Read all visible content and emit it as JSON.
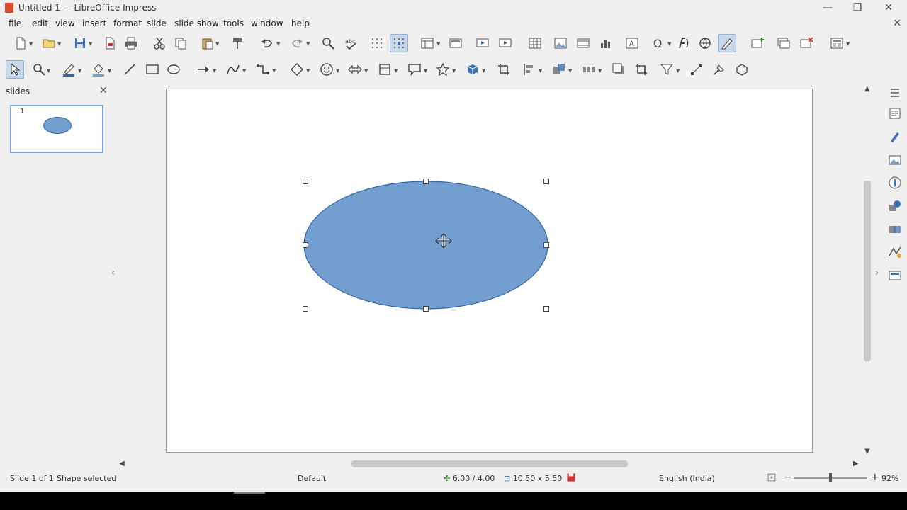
{
  "window": {
    "title": "Untitled 1 — LibreOffice Impress",
    "minimize_glyph": "—",
    "restore_glyph": "❐",
    "close_glyph": "✕"
  },
  "menu": [
    "file",
    "edit",
    "view",
    "insert",
    "format",
    "slide",
    "slide show",
    "tools",
    "window",
    "help"
  ],
  "standard_toolbar": [
    "new-icon",
    "open-icon",
    "save-icon",
    "export-pdf-icon",
    "print-icon",
    "cut-icon",
    "copy-icon",
    "paste-icon",
    "clone-formatting-icon",
    "undo-icon",
    "redo-icon",
    "find-replace-icon",
    "spelling-icon",
    "display-grid-icon",
    "snap-to-grid-icon",
    "display-views-icon",
    "master-slide-icon",
    "start-first-slide-icon",
    "start-current-slide-icon",
    "table-icon",
    "image-icon",
    "media-icon",
    "chart-icon",
    "text-box-icon",
    "special-character-icon",
    "fontwork-icon",
    "hyperlink-icon",
    "show-draw-functions-icon",
    "new-slide-icon",
    "duplicate-slide-icon",
    "delete-slide-icon",
    "slide-layout-icon"
  ],
  "drawing_toolbar": [
    "select-icon",
    "zoom-pan-icon",
    "line-color-icon",
    "fill-color-icon",
    "line-icon",
    "rectangle-icon",
    "ellipse-icon",
    "lines-arrows-icon",
    "curves-polygons-icon",
    "connectors-icon",
    "basic-shapes-icon",
    "symbol-shapes-icon",
    "block-arrows-icon",
    "flowchart-icon",
    "callouts-icon",
    "stars-icon",
    "3d-objects-icon",
    "rotate-icon",
    "align-icon",
    "arrange-icon",
    "distribute-icon",
    "shadow-icon",
    "crop-icon",
    "filter-icon",
    "points-icon",
    "glue-points-icon",
    "toggle-extrusion-icon"
  ],
  "slides_pane": {
    "title": "slides",
    "close_glyph": "✕",
    "slide_number": "1"
  },
  "canvas": {
    "shape": "ellipse",
    "fill_color": "#729fcf",
    "stroke_color": "#3465a4"
  },
  "sidebar": [
    "properties-icon",
    "styles-icon",
    "gallery-icon",
    "navigator-icon",
    "shapes-icon",
    "slide-transition-icon",
    "animation-icon",
    "master-slides-icon"
  ],
  "status": {
    "slide_info": "Slide 1 of 1",
    "selection": "Shape selected",
    "master": "Default",
    "position": "6.00 / 4.00",
    "size": "10.50 x 5.50",
    "language": "English (India)",
    "zoom": "92%",
    "zoom_fraction": 0.5
  },
  "colors": {
    "accent": "#729fcf",
    "toolbar_active": "#c9d8ea"
  }
}
